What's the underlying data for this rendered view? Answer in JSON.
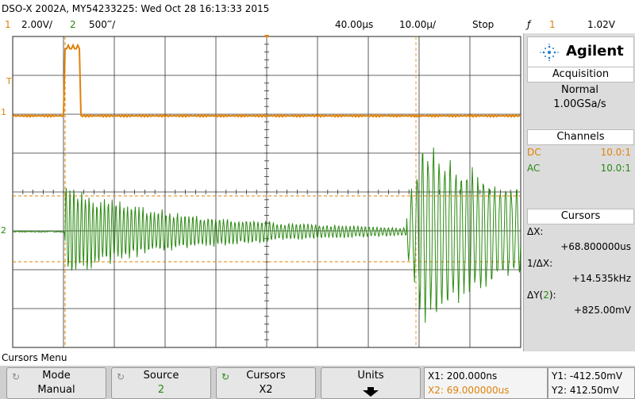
{
  "titlebar": {
    "title": "DSO-X 2002A, MY54233225: Wed Oct 28 16:13:33 2015"
  },
  "statusbar": {
    "ch1_num": "1",
    "ch1_scale": "2.00V/",
    "ch2_num": "2",
    "ch2_scale": "500‴/",
    "delay": "40.00µs",
    "timebase": "10.00µ/",
    "run_state": "Stop",
    "trigger_icon": "trigger-edge-icon",
    "trigger_symbol": "ƒ",
    "trigger_channel": "1",
    "trigger_level": "1.02V"
  },
  "scope": {
    "trig_marker": "T",
    "ch1_marker": "1",
    "ch2_marker": "2",
    "colors": {
      "ch1": "#e0820a",
      "ch2": "#2a8a10",
      "grid": "#000000"
    }
  },
  "panel": {
    "brand": "Agilent",
    "brand_icon": "agilent-spark-icon",
    "acquisition": {
      "title": "Acquisition",
      "mode": "Normal",
      "rate": "1.00GSa/s"
    },
    "channels": {
      "title": "Channels",
      "ch1_coupling": "DC",
      "ch1_probe": "10.0:1",
      "ch2_coupling": "AC",
      "ch2_probe": "10.0:1"
    },
    "cursors": {
      "title": "Cursors",
      "dx_label": "ΔX:",
      "dx_value": "+68.800000us",
      "inv_dx_label": "1/ΔX:",
      "inv_dx_value": "+14.535kHz",
      "dy_label": "ΔY(",
      "dy_channel": "2",
      "dy_close": "):",
      "dy_value": "+825.00mV"
    }
  },
  "menu": {
    "title": "Cursors Menu",
    "softkeys": [
      {
        "l1": "Mode",
        "l2": "Manual"
      },
      {
        "l1": "Source",
        "l2": "2"
      },
      {
        "l1": "Cursors",
        "l2": "X2"
      },
      {
        "l1": "Units",
        "l2": ""
      }
    ],
    "readout": {
      "x1": "X1: 200.000ns",
      "x2": "X2: 69.000000us",
      "y1": "Y1: -412.50mV",
      "y2": "Y2: 412.50mV"
    }
  }
}
